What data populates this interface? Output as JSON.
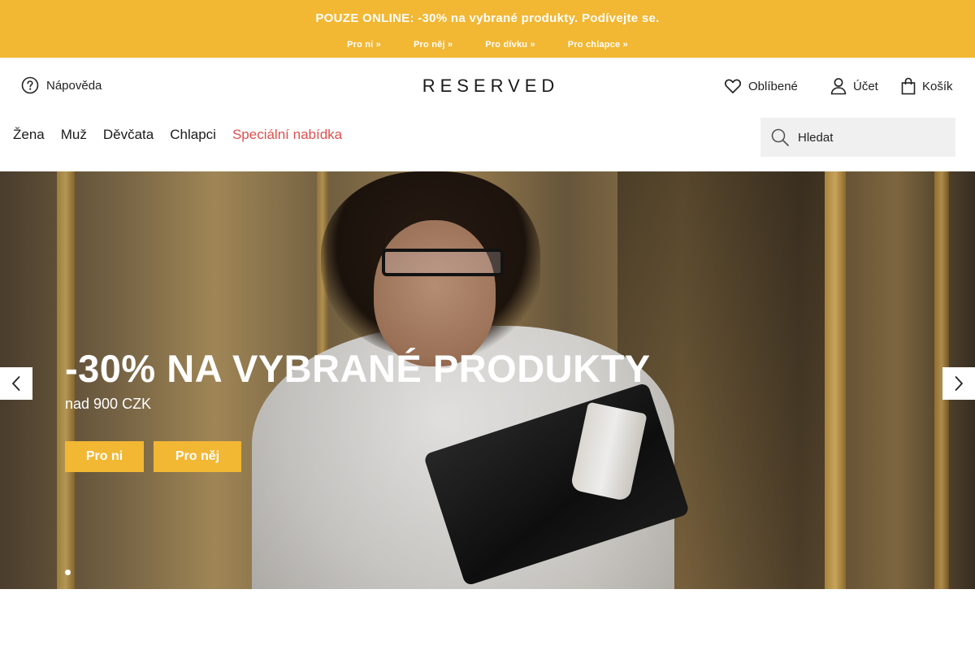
{
  "promo": {
    "title": "POUZE ONLINE: -30% na vybrané produkty. Podívejte se.",
    "links": [
      "Pro ni »",
      "Pro něj »",
      "Pro dívku »",
      "Pro chlapce »"
    ],
    "color": "#f2b733"
  },
  "header": {
    "help_label": "Nápověda",
    "logo": "RESERVED",
    "favorites_label": "Oblíbené",
    "account_label": "Účet",
    "cart_label": "Košík"
  },
  "nav": {
    "items": [
      "Žena",
      "Muž",
      "Děvčata",
      "Chlapci"
    ],
    "special": "Speciální nabídka",
    "special_color": "#e0504e"
  },
  "search": {
    "placeholder": "Hledat"
  },
  "hero": {
    "heading": "-30% NA VYBRANÉ PRODUKTY",
    "subheading": "nad 900 CZK",
    "buttons": [
      "Pro ni",
      "Pro něj"
    ],
    "slide_count": 1,
    "active_slide": 1
  },
  "icons": [
    "help-icon",
    "heart-icon",
    "user-icon",
    "bag-icon",
    "search-icon",
    "chevron-left-icon",
    "chevron-right-icon"
  ]
}
